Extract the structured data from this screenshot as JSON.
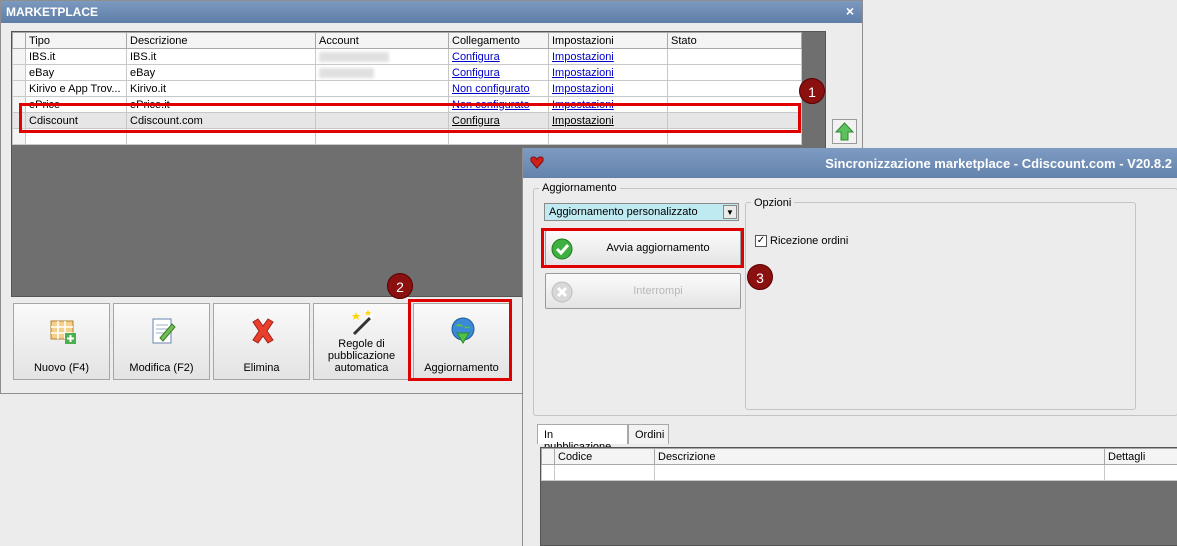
{
  "marketplace": {
    "title": "MARKETPLACE",
    "close": "×",
    "columns": [
      "Tipo",
      "Descrizione",
      "Account",
      "Collegamento",
      "Impostazioni",
      "Stato"
    ],
    "rows": [
      {
        "tipo": "IBS.it",
        "descrizione": "IBS.it",
        "collegamento": "Configura",
        "impostazioni": "Impostazioni",
        "stato": ""
      },
      {
        "tipo": "eBay",
        "descrizione": "eBay",
        "collegamento": "Configura",
        "impostazioni": "Impostazioni",
        "stato": ""
      },
      {
        "tipo": "Kirivo e App Trov...",
        "descrizione": "Kirivo.it",
        "collegamento": "Non configurato",
        "impostazioni": "Impostazioni",
        "stato": ""
      },
      {
        "tipo": "ePrice",
        "descrizione": "ePrice.it",
        "collegamento": "Non configurato",
        "impostazioni": "Impostazioni",
        "stato": ""
      },
      {
        "tipo": "Cdiscount",
        "descrizione": "Cdiscount.com",
        "collegamento": "Configura",
        "impostazioni": "Impostazioni",
        "stato": ""
      }
    ],
    "toolbar": {
      "new_label": "Nuovo (F4)",
      "edit_label": "Modifica (F2)",
      "delete_label": "Elimina",
      "rules_label": "Regole di pubblicazione automatica",
      "update_label": "Aggiornamento"
    }
  },
  "sync": {
    "title": "Sincronizzazione marketplace - Cdiscount.com - V20.8.2",
    "update_group_label": "Aggiornamento",
    "mode_value": "Aggiornamento personalizzato",
    "start_label": "Avvia aggiornamento",
    "stop_label": "Interrompi",
    "options_label": "Opzioni",
    "orders_option_label": "Ricezione ordini",
    "tabs": [
      "In pubblicazione",
      "Ordini"
    ],
    "bottom_columns": [
      "Codice",
      "Descrizione",
      "Dettagli"
    ]
  },
  "badges": [
    "1",
    "2",
    "3"
  ],
  "colors": {
    "highlight": "#e00000",
    "badge": "#8b1010",
    "titlebar": "#6483ac",
    "link": "#0000cc",
    "selector": "#bfeaf2"
  }
}
